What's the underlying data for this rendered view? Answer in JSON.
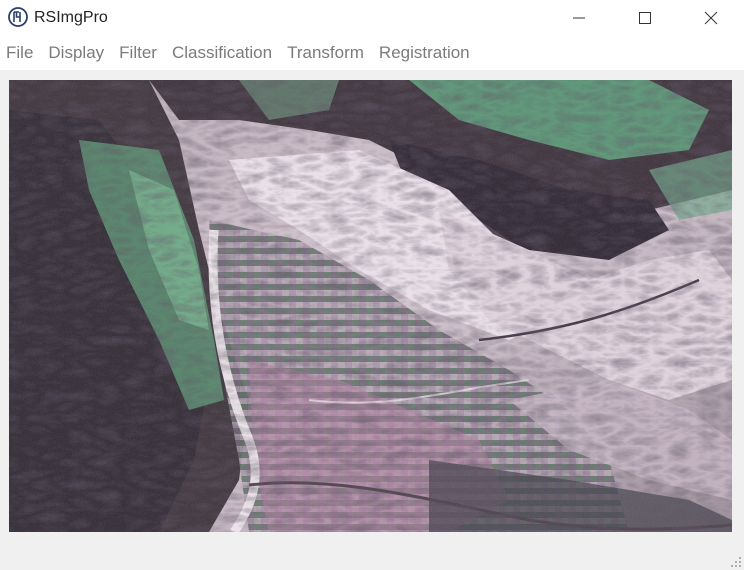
{
  "window": {
    "title": "RSImgPro",
    "icon": "app-logo-icon",
    "controls": [
      "minimize-icon",
      "maximize-icon",
      "close-icon"
    ]
  },
  "menu": {
    "items": [
      {
        "label": "File"
      },
      {
        "label": "Display"
      },
      {
        "label": "Filter"
      },
      {
        "label": "Classification"
      },
      {
        "label": "Transform"
      },
      {
        "label": "Registration"
      }
    ]
  },
  "image": {
    "description_icon": "satellite-image",
    "colors": {
      "vegetation": "#5fa07a",
      "shadow": "#2c2530",
      "bare_soil": "#d8c6d0",
      "urban": "#b27ea0",
      "highlight": "#f2eaf0"
    }
  }
}
